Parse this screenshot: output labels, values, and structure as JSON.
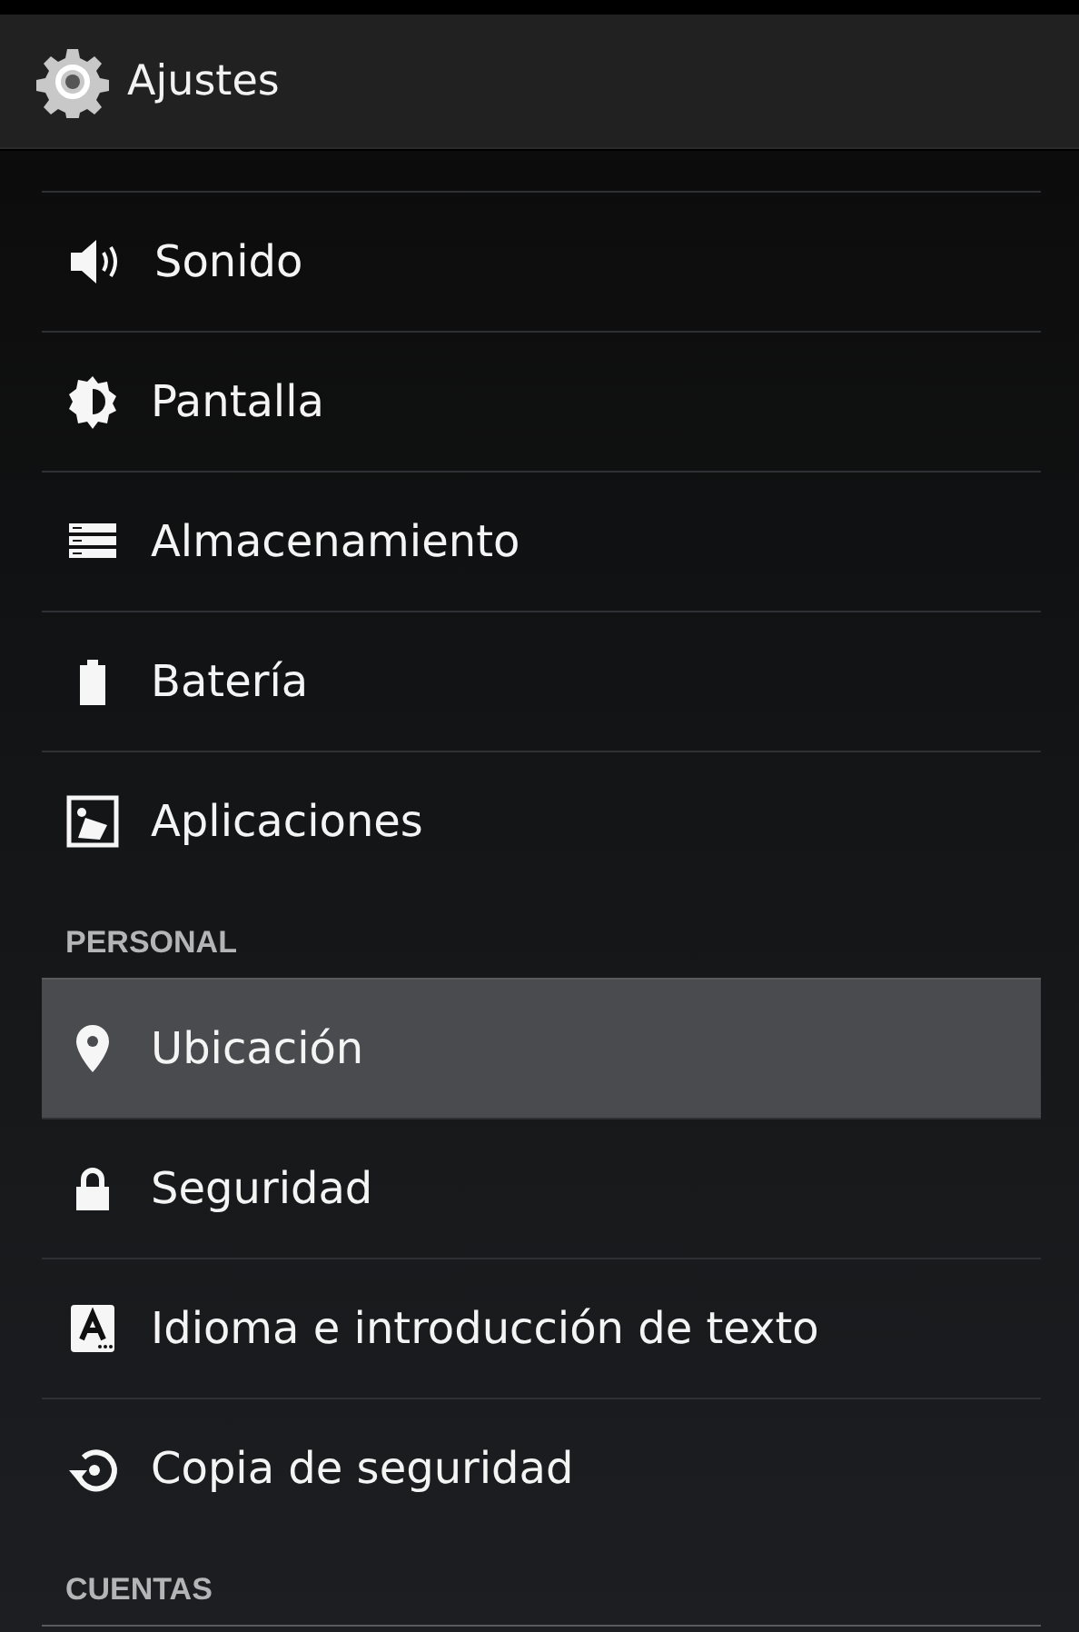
{
  "action_bar": {
    "title": "Ajustes"
  },
  "sections": [
    {
      "items": [
        {
          "label": "Sonido",
          "selected": false
        },
        {
          "label": "Pantalla",
          "selected": false
        },
        {
          "label": "Almacenamiento",
          "selected": false
        },
        {
          "label": "Batería",
          "selected": false
        },
        {
          "label": "Aplicaciones",
          "selected": false
        }
      ]
    },
    {
      "header": "PERSONAL",
      "items": [
        {
          "label": "Ubicación",
          "selected": true
        },
        {
          "label": "Seguridad",
          "selected": false
        },
        {
          "label": "Idioma e introducción de texto",
          "selected": false
        },
        {
          "label": "Copia de seguridad",
          "selected": false
        }
      ]
    },
    {
      "header": "CUENTAS"
    }
  ]
}
